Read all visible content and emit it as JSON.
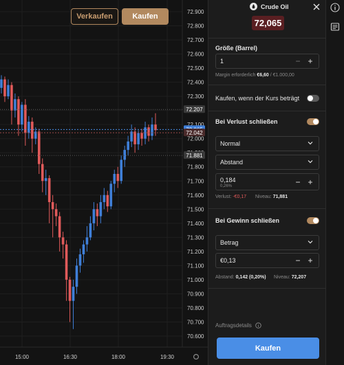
{
  "chart": {
    "sell_label": "Verkaufen",
    "buy_label": "Kaufen",
    "price_ticks": [
      "72.900",
      "72.800",
      "72.700",
      "72.600",
      "72.500",
      "72.400",
      "72.300",
      "72.200",
      "72.100",
      "72.000",
      "71.900",
      "71.800",
      "71.700",
      "71.600",
      "71.500",
      "71.400",
      "71.300",
      "71.200",
      "71.100",
      "71.000",
      "70.900",
      "70.800",
      "70.700",
      "70.600"
    ],
    "time_ticks": [
      "15:00",
      "16:30",
      "18:00",
      "19:30"
    ],
    "lines": [
      {
        "price": 72.207,
        "label": "72.207",
        "type": "take-profit"
      },
      {
        "price": 72.065,
        "label": "72.065",
        "type": "current"
      },
      {
        "price": 72.042,
        "label": "72.042",
        "type": "bid"
      },
      {
        "price": 71.881,
        "label": "71.881",
        "type": "stop-loss"
      }
    ],
    "colors": {
      "up": "#3f7fd8",
      "down": "#e05a5a",
      "accent": "#b2895f"
    },
    "candles": [
      [
        72.36,
        72.42,
        72.32,
        72.45
      ],
      [
        72.42,
        72.3,
        72.26,
        72.44
      ],
      [
        72.3,
        72.38,
        72.28,
        72.42
      ],
      [
        72.38,
        72.2,
        72.1,
        72.4
      ],
      [
        72.2,
        72.28,
        72.15,
        72.32
      ],
      [
        72.28,
        72.1,
        72.02,
        72.3
      ],
      [
        72.1,
        72.24,
        72.05,
        72.26
      ],
      [
        72.24,
        72.04,
        71.95,
        72.28
      ],
      [
        72.04,
        72.12,
        72.0,
        72.16
      ],
      [
        72.12,
        72.0,
        71.9,
        72.15
      ],
      [
        72.0,
        72.05,
        71.96,
        72.08
      ],
      [
        72.05,
        71.82,
        71.75,
        72.07
      ],
      [
        71.82,
        71.7,
        71.62,
        71.86
      ],
      [
        71.7,
        71.72,
        71.6,
        71.78
      ],
      [
        71.72,
        71.55,
        71.4,
        71.74
      ],
      [
        71.55,
        71.5,
        71.3,
        71.6
      ],
      [
        71.5,
        71.45,
        71.38,
        71.54
      ],
      [
        71.45,
        71.3,
        71.2,
        71.48
      ],
      [
        71.3,
        71.25,
        71.15,
        71.34
      ],
      [
        71.25,
        71.0,
        70.85,
        71.28
      ],
      [
        71.0,
        70.85,
        70.7,
        71.02
      ],
      [
        70.85,
        70.95,
        70.65,
        71.0
      ],
      [
        70.95,
        71.1,
        70.9,
        71.15
      ],
      [
        71.1,
        71.18,
        71.05,
        71.22
      ],
      [
        71.18,
        71.25,
        71.12,
        71.28
      ],
      [
        71.25,
        71.3,
        71.2,
        71.38
      ],
      [
        71.3,
        71.4,
        71.28,
        71.45
      ],
      [
        71.4,
        71.5,
        71.35,
        71.55
      ],
      [
        71.5,
        71.45,
        71.38,
        71.54
      ],
      [
        71.45,
        71.55,
        71.4,
        71.6
      ],
      [
        71.55,
        71.6,
        71.5,
        71.65
      ],
      [
        71.6,
        71.52,
        71.48,
        71.63
      ],
      [
        71.52,
        71.68,
        71.5,
        71.7
      ],
      [
        71.68,
        71.75,
        71.62,
        71.78
      ],
      [
        71.75,
        71.7,
        71.65,
        71.8
      ],
      [
        71.7,
        71.85,
        71.68,
        71.88
      ],
      [
        71.85,
        71.92,
        71.8,
        71.95
      ],
      [
        71.92,
        71.98,
        71.88,
        72.02
      ],
      [
        71.98,
        72.05,
        71.94,
        72.1
      ],
      [
        72.05,
        71.96,
        71.9,
        72.08
      ],
      [
        71.96,
        72.04,
        71.92,
        72.06
      ],
      [
        72.04,
        72.0,
        71.95,
        72.07
      ],
      [
        72.0,
        72.08,
        71.96,
        72.12
      ],
      [
        72.08,
        72.02,
        71.98,
        72.1
      ],
      [
        72.02,
        72.1,
        71.99,
        72.15
      ],
      [
        72.1,
        72.06,
        72.02,
        72.18
      ]
    ]
  },
  "panel": {
    "instrument": "Crude Oil",
    "price": "72,065",
    "size_label": "Größe (Barrel)",
    "size_value": "1",
    "margin_label": "Margin erforderlich",
    "margin_value": "€6,60",
    "margin_available": "€1.000,00",
    "buy_at_price_label": "Kaufen, wenn der Kurs beträgt",
    "stop_loss_label": "Bei Verlust schließen",
    "stop_type": "Normal",
    "stop_mode": "Abstand",
    "stop_value": "0,184",
    "stop_percent": "0,26%",
    "loss_label": "Verlust:",
    "loss_value": "-€0,17",
    "stop_level_label": "Niveau:",
    "stop_level_value": "71,881",
    "take_profit_label": "Bei Gewinn schließen",
    "tp_mode": "Betrag",
    "tp_value": "€0,13",
    "distance_label": "Abstand:",
    "distance_value": "0,142 (0,20%)",
    "tp_level_label": "Niveau:",
    "tp_level_value": "72,207",
    "order_details_label": "Auftragsdetails",
    "submit_label": "Kaufen"
  }
}
